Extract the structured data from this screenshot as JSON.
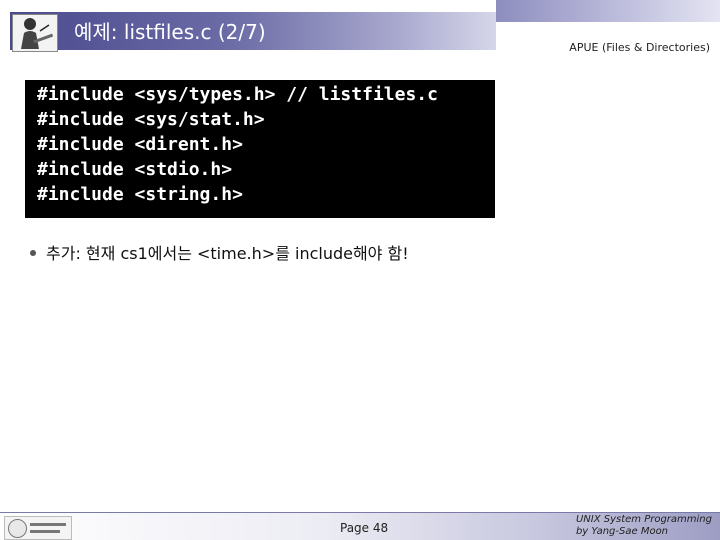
{
  "header": {
    "title": "예제: listfiles.c (2/7)",
    "right_text": "APUE (Files & Directories)"
  },
  "code_lines": [
    "#include <sys/types.h> // listfiles.c",
    "#include <sys/stat.h>",
    "#include <dirent.h>",
    "#include <stdio.h>",
    "#include <string.h>"
  ],
  "bullet": {
    "text": "추가: 현재 cs1에서는 <time.h>를 include해야 함!"
  },
  "footer": {
    "page": "Page 48",
    "right_line1": "UNIX System Programming",
    "right_line2": "by Yang-Sae Moon"
  },
  "colors": {
    "title_bar": "#4a4a8e",
    "code_bg": "#000000",
    "code_fg": "#ffffff"
  },
  "icons": {
    "title_logo": "professor-writing-icon",
    "footer_logo": "university-seal-icon"
  }
}
